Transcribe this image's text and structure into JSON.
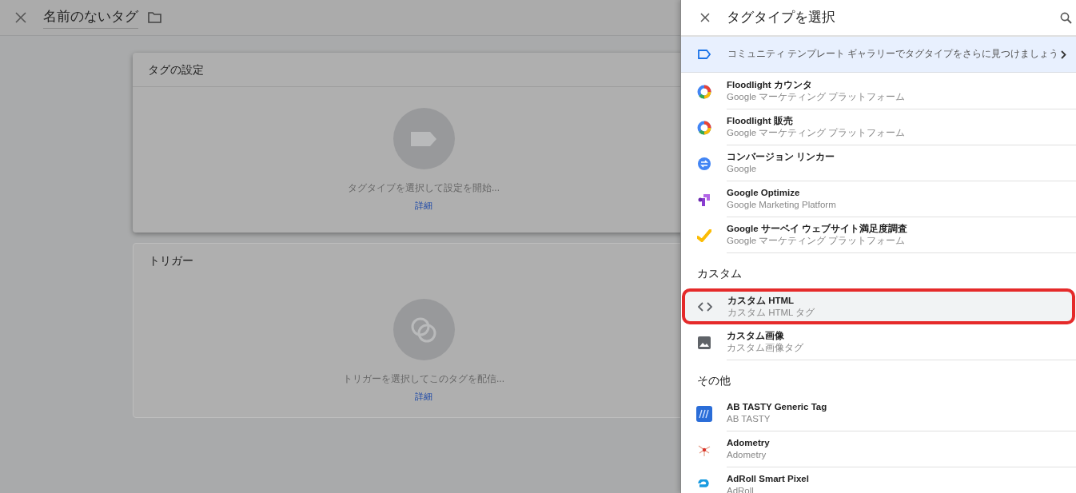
{
  "editor": {
    "title": "名前のないタグ",
    "cards": [
      {
        "kind": "tag",
        "title": "タグの設定",
        "hint": "タグタイプを選択して設定を開始...",
        "link": "詳細"
      },
      {
        "kind": "trigger",
        "title": "トリガー",
        "hint": "トリガーを選択してこのタグを配信...",
        "link": "詳細"
      }
    ]
  },
  "panel": {
    "title": "タグタイプを選択",
    "banner": "コミュニティ テンプレート ギャラリーでタグタイプをさらに見つけましょう",
    "sections": [
      {
        "items": [
          {
            "kind": "floodlight",
            "name": "Floodlight カウンタ",
            "vendor": "Google マーケティング プラットフォーム",
            "selected": false
          },
          {
            "kind": "floodlight",
            "name": "Floodlight 販売",
            "vendor": "Google マーケティング プラットフォーム",
            "selected": false
          },
          {
            "kind": "linker",
            "name": "コンバージョン リンカー",
            "vendor": "Google",
            "selected": false
          },
          {
            "kind": "optimize",
            "name": "Google Optimize",
            "vendor": "Google Marketing Platform",
            "selected": false
          },
          {
            "kind": "survey",
            "name": "Google サーベイ ウェブサイト満足度調査",
            "vendor": "Google マーケティング プラットフォーム",
            "selected": false
          }
        ]
      },
      {
        "title": "カスタム",
        "items": [
          {
            "kind": "code",
            "name": "カスタム HTML",
            "vendor": "カスタム HTML タグ",
            "selected": true
          },
          {
            "kind": "image",
            "name": "カスタム画像",
            "vendor": "カスタム画像タグ",
            "selected": false
          }
        ]
      },
      {
        "title": "その他",
        "items": [
          {
            "kind": "abtasty",
            "name": "AB TASTY Generic Tag",
            "vendor": "AB TASTY",
            "selected": false
          },
          {
            "kind": "adometry",
            "name": "Adometry",
            "vendor": "Adometry",
            "selected": false
          },
          {
            "kind": "adroll",
            "name": "AdRoll Smart Pixel",
            "vendor": "AdRoll",
            "selected": false
          }
        ]
      }
    ]
  }
}
